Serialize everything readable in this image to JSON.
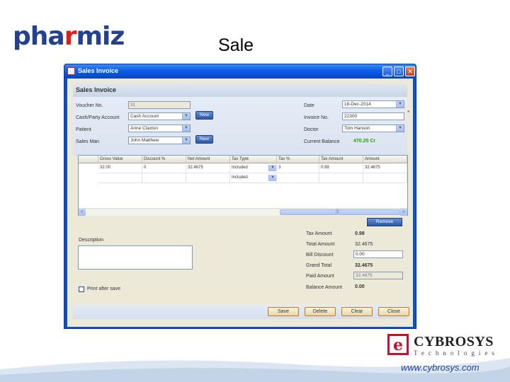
{
  "slide": {
    "logo_prefix": "pha",
    "logo_r": "r",
    "logo_suffix": "miz",
    "title": "Sale",
    "company_name": "CYBROSYS",
    "company_sub": "Technologies",
    "website": "www.cybrosys.com"
  },
  "window": {
    "title": "Sales Invoice",
    "min_label": "_",
    "max_label": "□",
    "close_label": "✕",
    "panel_title": "Sales Invoice"
  },
  "form": {
    "voucher_label": "Voucher No.",
    "voucher_value": "31",
    "cashparty_label": "Cash/Party Account",
    "cashparty_value": "Cash Account",
    "patient_label": "Patient",
    "patient_value": "Anne Claxton",
    "salesman_label": "Sales Man",
    "salesman_value": "John Matthew",
    "new_label": "New",
    "date_label": "Date",
    "date_value": "18-Dec-2014",
    "invoice_label": "Invoice No.",
    "invoice_value": "22300",
    "doctor_label": "Doctor",
    "doctor_value": "Tom Hanson",
    "balance_label": "Current Balance",
    "balance_value": "470.25 Cr",
    "star": "*"
  },
  "grid": {
    "headers": [
      "Gross Value",
      "Discount %",
      "Net Amount",
      "Tax Type",
      "Tax %",
      "Tax Amount",
      "Amount"
    ],
    "rows": [
      [
        "32.00",
        "0",
        "32.4675",
        "Included",
        "3",
        "0.98",
        "32.4675"
      ],
      [
        "",
        "",
        "",
        "Included",
        "",
        "",
        ""
      ]
    ],
    "scroll_left": "<",
    "scroll_right": ">",
    "scroll_thumb_mark": "|||"
  },
  "remove_label": "Remove",
  "description_label": "Description",
  "print_after_save_label": "Print after save",
  "summary": {
    "tax_amount_label": "Tax Amount",
    "tax_amount_value": "0.98",
    "total_amount_label": "Total Amount",
    "total_amount_value": "32.4675",
    "bill_discount_label": "Bill Discount",
    "bill_discount_value": "0.00",
    "grand_total_label": "Grand Total",
    "grand_total_value": "32.4675",
    "paid_amount_label": "Paid Amount",
    "paid_amount_value": "32.4675",
    "balance_amount_label": "Balance Amount",
    "balance_amount_value": "0.00"
  },
  "buttons": {
    "save": "Save",
    "delete": "Delete",
    "clear": "Clear",
    "close": "Close"
  },
  "colors": {
    "window_blue": "#0a4fcc",
    "balance_green": "#22a00a",
    "logo_blue": "#23418f",
    "logo_red": "#d9211f"
  }
}
